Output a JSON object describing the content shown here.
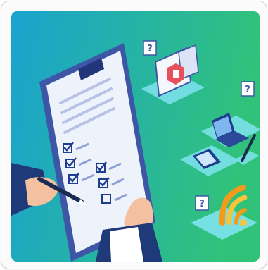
{
  "illustration": {
    "description_icons": [
      "clipboard-checklist",
      "hands-with-pen",
      "security-alert-screen",
      "laptop",
      "tablet",
      "wifi-signal"
    ],
    "badges": {
      "q1": "?",
      "q2": "?",
      "q3": "?"
    },
    "colors": {
      "gradient_left": "#1fa2c7",
      "gradient_right": "#2ec27a",
      "clipboard": "#3d57a6",
      "paper": "#eef2fb",
      "check": "#1e3d8f",
      "sleeve": "#1f3a78",
      "skin": "#f3c19f",
      "tile": "#7fe3ee",
      "alert_red": "#e8505b",
      "wifi_orange": "#f29a1b",
      "wifi_yellow": "#f7c53b"
    }
  }
}
